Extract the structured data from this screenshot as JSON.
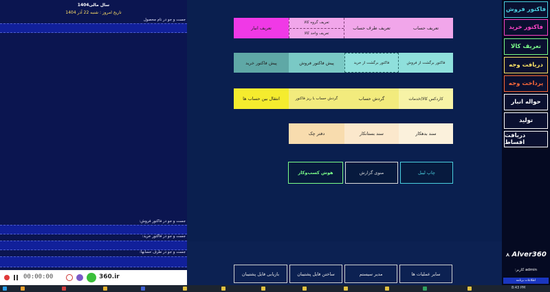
{
  "left": {
    "title": "سال مالی1404",
    "date": "تاریخ امروز : شنبه 22 آذر 1404",
    "product_search_label": "جست و جو در نام محصول",
    "sales_search_label": "جست و جو در فاکتور فروش:",
    "purchase_search_label": "جست و جو در فاکتور خرید:",
    "account_search_label": "جست و جو در طرف حسابها:"
  },
  "recorder": {
    "time": "00:00:00",
    "site": "360.ir"
  },
  "grid": {
    "row1": {
      "define_account": "تعریف حساب",
      "define_party": "تعریف طرف حساب",
      "define_group": "تعریف گروه کالا",
      "define_unit": "تعریف واحد کالا",
      "define_warehouse": "تعریف انبار"
    },
    "row2": {
      "sales_return": "فاکتور برگشت از فروش",
      "purchase_return": "فاکتور برگشت از خرید",
      "proforma_sales": "پیش فاکتور فروش",
      "proforma_purchase": "پیش فاکتور خرید"
    },
    "row3": {
      "item_card": "کاردکس کالا/خدمات",
      "account_turnover": "گردش حساب",
      "turnover_detail": "گردش حساب با ریز فاکتور",
      "transfer": "انتقال بین حساب ها"
    },
    "row4": {
      "debtor_doc": "سند بدهکار",
      "creditor_doc": "سند بستانکار",
      "checkbook": "دفتر چک"
    },
    "row5": {
      "print_label": "چاپ لیبل",
      "reports_menu": "منوی گزارش",
      "business_ai": "هوش کسب‌وکار"
    }
  },
  "bottom": {
    "other_ops": "سایر عملیات ها",
    "sys_admin": "مدیر سیستم",
    "make_backup": "ساختن فایل پشتیبان",
    "restore_backup": "بازیابی فایل پشتیبان"
  },
  "sidebar": {
    "items": [
      {
        "label": "فاکتور فروش",
        "color": "#4ad0e0"
      },
      {
        "label": "فاکتور خرید",
        "color": "#ff44c8"
      },
      {
        "label": "تعریف کالا",
        "color": "#7cff8a"
      },
      {
        "label": "دریافت وجه",
        "color": "#ffe566"
      },
      {
        "label": "پرداخت وجه",
        "color": "#ff6a3a"
      },
      {
        "label": "حواله انبار",
        "color": "#ffffff"
      },
      {
        "label": "تولید",
        "color": "#ffffff"
      },
      {
        "label": "دریافت اقساط",
        "color": "#ffffff"
      }
    ],
    "logo": "Alver360",
    "user": "admin  کاربر:",
    "info": "اطلاعات برنامه"
  },
  "taskbar": {
    "time": "8:43 PM"
  }
}
